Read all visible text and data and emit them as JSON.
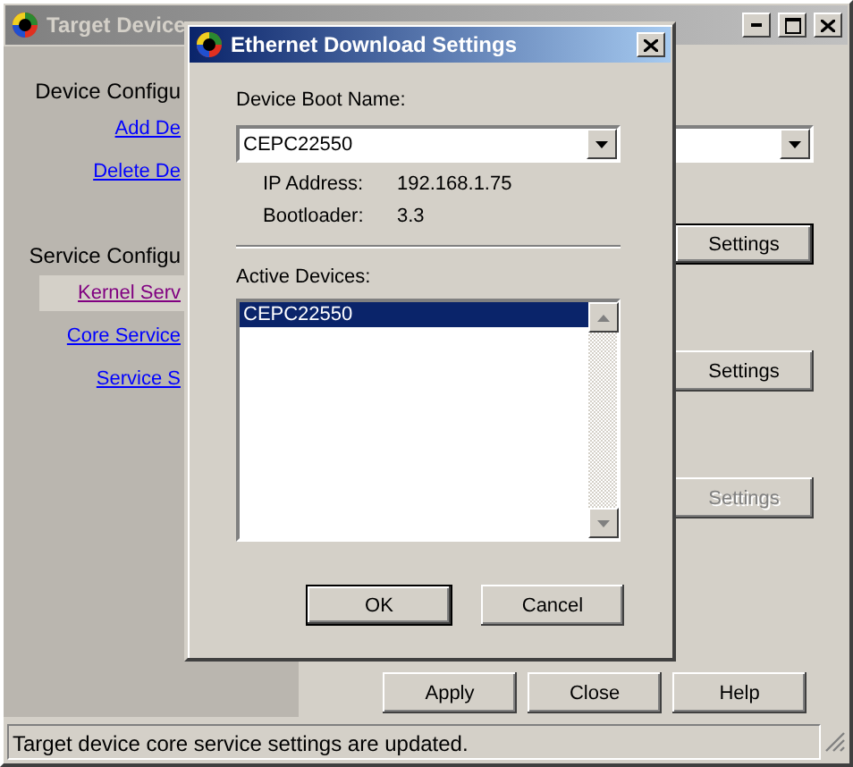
{
  "main_window": {
    "title": "Target Device"
  },
  "sidebar": {
    "sections": [
      {
        "heading": "Device Configu",
        "links": [
          {
            "label": "Add De",
            "selected": false
          },
          {
            "label": "Delete De",
            "selected": false
          }
        ]
      },
      {
        "heading": "Service Configu",
        "links": [
          {
            "label": "Kernel Serv",
            "selected": true
          },
          {
            "label": "Core Service",
            "selected": false
          },
          {
            "label": "Service S",
            "selected": false
          }
        ]
      }
    ]
  },
  "settings_buttons": [
    {
      "label": "Settings",
      "default": true,
      "disabled": false
    },
    {
      "label": "Settings",
      "default": false,
      "disabled": false
    },
    {
      "label": "Settings",
      "default": false,
      "disabled": true
    }
  ],
  "footer_buttons": [
    {
      "label": "Apply"
    },
    {
      "label": "Close"
    },
    {
      "label": "Help"
    }
  ],
  "status_bar": "Target device core service settings are updated.",
  "dialog": {
    "title": "Ethernet Download Settings",
    "boot_name_label": "Device Boot Name:",
    "boot_name": "CEPC22550",
    "info": [
      {
        "label": "IP Address:",
        "value": "192.168.1.75"
      },
      {
        "label": "Bootloader:",
        "value": "3.3"
      }
    ],
    "active_devices_label": "Active Devices:",
    "active_devices": [
      {
        "name": "CEPC22550",
        "selected": true
      }
    ],
    "buttons": [
      {
        "label": "OK",
        "default": true
      },
      {
        "label": "Cancel",
        "default": false
      }
    ]
  }
}
